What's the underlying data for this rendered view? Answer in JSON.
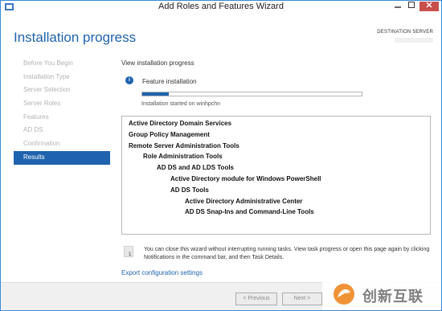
{
  "window": {
    "title": "Add Roles and Features Wizard"
  },
  "header": {
    "page_title": "Installation progress",
    "destination_label": "DESTINATION SERVER"
  },
  "sidebar": {
    "items": [
      {
        "label": "Before You Begin",
        "active": false
      },
      {
        "label": "Installation Type",
        "active": false
      },
      {
        "label": "Server Selection",
        "active": false
      },
      {
        "label": "Server Roles",
        "active": false
      },
      {
        "label": "Features",
        "active": false
      },
      {
        "label": "AD DS",
        "active": false
      },
      {
        "label": "Confirmation",
        "active": false
      },
      {
        "label": "Results",
        "active": true
      }
    ]
  },
  "main": {
    "section_label": "View installation progress",
    "status_title": "Feature installation",
    "progress_fraction": 0.12,
    "status_detail": "Installation started on winhpchn",
    "results": [
      {
        "text": "Active Directory Domain Services",
        "level": 0
      },
      {
        "text": "Group Policy Management",
        "level": 0
      },
      {
        "text": "Remote Server Administration Tools",
        "level": 0
      },
      {
        "text": "Role Administration Tools",
        "level": 1
      },
      {
        "text": "AD DS and AD LDS Tools",
        "level": 2
      },
      {
        "text": "Active Directory module for Windows PowerShell",
        "level": 3
      },
      {
        "text": "AD DS Tools",
        "level": 3
      },
      {
        "text": "Active Directory Administrative Center",
        "level": 4
      },
      {
        "text": "AD DS Snap-Ins and Command-Line Tools",
        "level": 4
      }
    ],
    "note": "You can close this wizard without interrupting running tasks. View task progress or open this page again by clicking Notifications in the command bar, and then Task Details.",
    "note_icon_badge": "1",
    "export_link": "Export configuration settings"
  },
  "footer": {
    "previous_label": "< Previous",
    "next_label": "Next >"
  },
  "watermark": {
    "text": "创新互联"
  },
  "colors": {
    "accent": "#1f63ae",
    "close_button": "#c7504b",
    "watermark_orange": "#f08e2c"
  }
}
